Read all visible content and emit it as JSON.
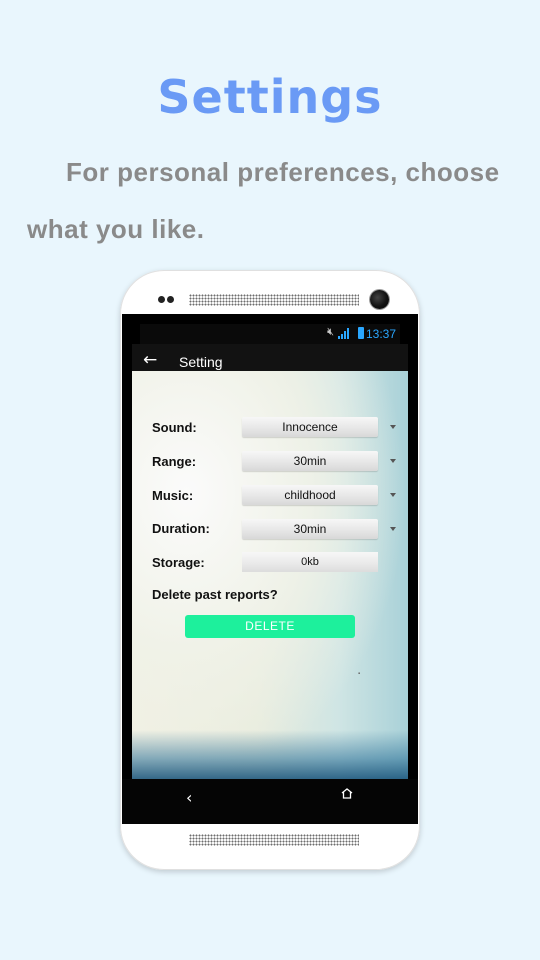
{
  "promo": {
    "title": "Settings",
    "line1": "For personal preferences, choose",
    "line2": "what you like."
  },
  "status_bar": {
    "time": "13:37",
    "icons": [
      "silent-mode-icon",
      "hd-icon",
      "signal-icon",
      "battery-icon"
    ]
  },
  "action_bar": {
    "title": "Setting",
    "back_icon": "back-arrow-icon"
  },
  "settings": {
    "sound": {
      "label": "Sound:",
      "value": "Innocence"
    },
    "range": {
      "label": "Range:",
      "value": "30min"
    },
    "music": {
      "label": "Music:",
      "value": "childhood"
    },
    "duration": {
      "label": "Duration:",
      "value": "30min"
    },
    "storage": {
      "label": "Storage:",
      "value": "0kb"
    },
    "delete_question": "Delete past reports?",
    "delete_button": "DELETE"
  },
  "colors": {
    "background": "#e9f6fd",
    "title": "#6a9af5",
    "subtitle": "#8a8a8a",
    "accent_button": "#1df09c",
    "status_accent": "#2aa7ff"
  }
}
